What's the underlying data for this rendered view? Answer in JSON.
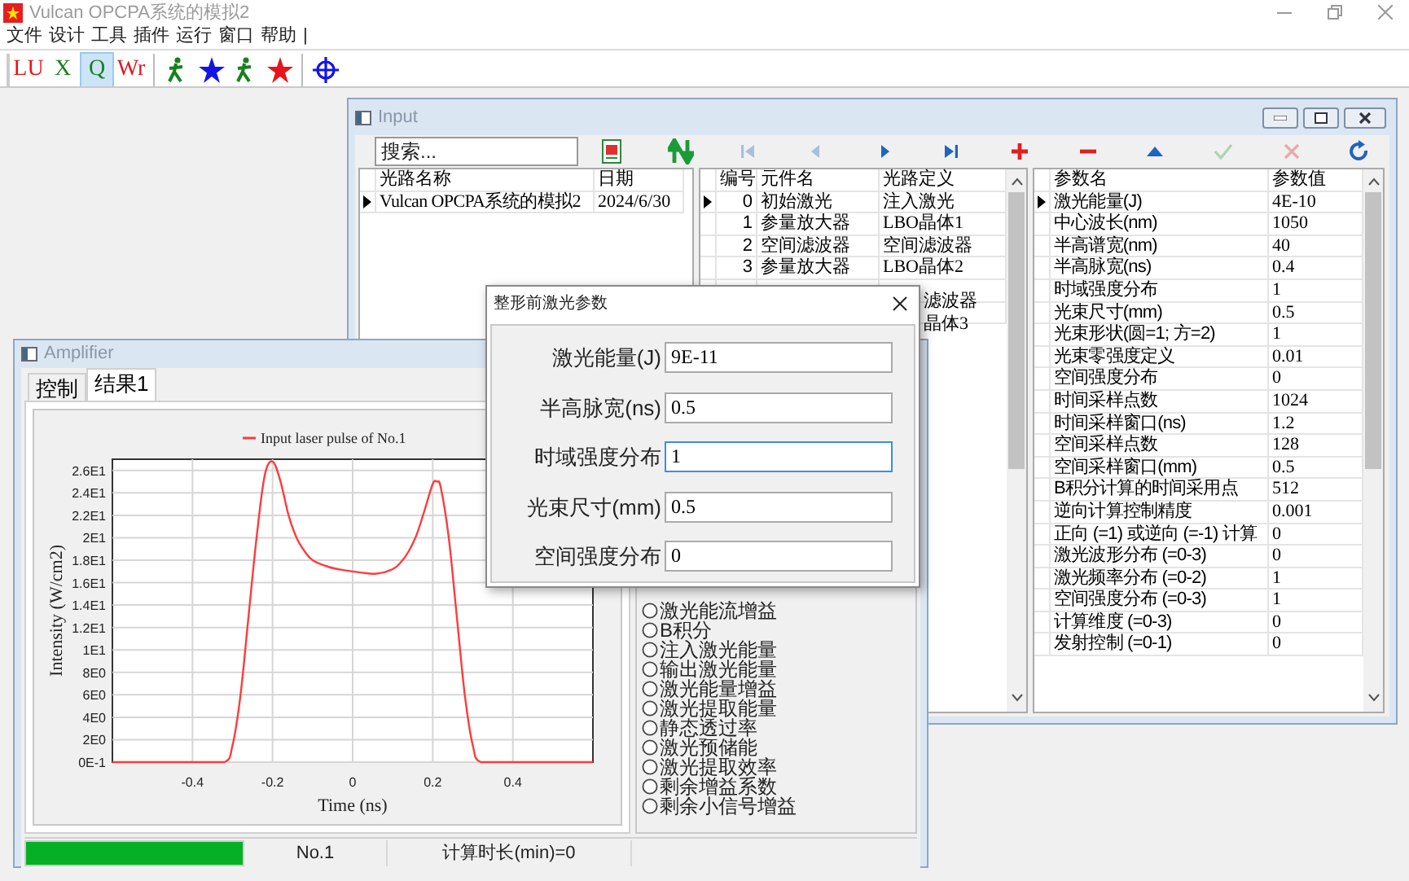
{
  "app": {
    "title": "Vulcan OPCPA系统的模拟2"
  },
  "menu": [
    "文件",
    "设计",
    "工具",
    "插件",
    "运行",
    "窗口",
    "帮助",
    "|"
  ],
  "toolbar": [
    {
      "kind": "text",
      "label": "LU",
      "color": "#e8141b",
      "selected": false
    },
    {
      "kind": "text",
      "label": "X",
      "color": "#17801c",
      "selected": false
    },
    {
      "kind": "text",
      "label": "Q",
      "color": "#17801c",
      "selected": true
    },
    {
      "kind": "text",
      "label": "Wr",
      "color": "#e8141b",
      "selected": false
    },
    {
      "kind": "separator"
    },
    {
      "kind": "figure",
      "color": "#17801c",
      "selected": false
    },
    {
      "kind": "star",
      "color": "#1414e6",
      "selected": false
    },
    {
      "kind": "figure",
      "color": "#17801c",
      "selected": false
    },
    {
      "kind": "star",
      "color": "#e8141b",
      "selected": false
    },
    {
      "kind": "separator"
    },
    {
      "kind": "target",
      "color": "#1414e6",
      "selected": false
    }
  ],
  "input_window": {
    "title": "Input",
    "search": {
      "placeholder": "搜索..."
    },
    "tools": [
      {
        "kind": "report",
        "disabled": false
      },
      {
        "kind": "sort",
        "disabled": false
      },
      {
        "kind": "first",
        "disabled": true
      },
      {
        "kind": "prev",
        "disabled": true
      },
      {
        "kind": "next",
        "disabled": false
      },
      {
        "kind": "last",
        "disabled": false
      },
      {
        "kind": "add",
        "disabled": false
      },
      {
        "kind": "remove",
        "disabled": false
      },
      {
        "kind": "up",
        "disabled": false
      },
      {
        "kind": "confirm",
        "disabled": true
      },
      {
        "kind": "cancel",
        "disabled": true
      },
      {
        "kind": "refresh",
        "disabled": false
      }
    ],
    "paths": {
      "columns": [
        "光路名称",
        "日期"
      ],
      "rows": [
        {
          "name": "Vulcan OPCPA系统的模拟2",
          "date": "2024/6/30",
          "current": true
        }
      ]
    },
    "elements": {
      "columns": [
        "编号",
        "元件名",
        "光路定义"
      ],
      "rows": [
        {
          "no": "0",
          "name": "初始激光",
          "definition": "注入激光",
          "current": true
        },
        {
          "no": "1",
          "name": "参量放大器",
          "definition": "LBO晶体1",
          "current": false
        },
        {
          "no": "2",
          "name": "空间滤波器",
          "definition": "空间滤波器",
          "current": false
        },
        {
          "no": "3",
          "name": "参量放大器",
          "definition": "LBO晶体2",
          "current": false
        },
        {
          "definition": "滤波器"
        },
        {
          "definition": "晶体3"
        }
      ]
    },
    "params": {
      "columns": [
        "参数名",
        "参数值"
      ],
      "rows": [
        {
          "name": "激光能量(J)",
          "value": "4E-10",
          "current": true
        },
        {
          "name": "中心波长(nm)",
          "value": "1050",
          "current": false
        },
        {
          "name": "半高谱宽(nm)",
          "value": "40",
          "current": false
        },
        {
          "name": "半高脉宽(ns)",
          "value": "0.4",
          "current": false
        },
        {
          "name": "时域强度分布",
          "value": "1",
          "current": false
        },
        {
          "name": "光束尺寸(mm)",
          "value": "0.5",
          "current": false
        },
        {
          "name": "光束形状(圆=1; 方=2)",
          "value": "1",
          "current": false
        },
        {
          "name": "光束零强度定义",
          "value": "0.01",
          "current": false
        },
        {
          "name": "空间强度分布",
          "value": "0",
          "current": false
        },
        {
          "name": "时间采样点数",
          "value": "1024",
          "current": false
        },
        {
          "name": "时间采样窗口(ns)",
          "value": "1.2",
          "current": false
        },
        {
          "name": "空间采样点数",
          "value": "128",
          "current": false
        },
        {
          "name": "空间采样窗口(mm)",
          "value": "0.5",
          "current": false
        },
        {
          "name": "B积分计算的时间采用点",
          "value": "512",
          "current": false
        },
        {
          "name": "逆向计算控制精度",
          "value": "0.001",
          "current": false
        },
        {
          "name": "正向 (=1) 或逆向 (=-1) 计算",
          "value": "0",
          "current": false
        },
        {
          "name": "激光波形分布 (=0-3)",
          "value": "0",
          "current": false
        },
        {
          "name": "激光频率分布 (=0-2)",
          "value": "1",
          "current": false
        },
        {
          "name": "空间强度分布 (=0-3)",
          "value": "1",
          "current": false
        },
        {
          "name": "计算维度 (=0-3)",
          "value": "0",
          "current": false
        },
        {
          "name": "发射控制 (=0-1)",
          "value": "0",
          "current": false
        }
      ]
    }
  },
  "amplifier": {
    "title": "Amplifier",
    "tabs": [
      {
        "label": "控制",
        "selected": false
      },
      {
        "label": "结果1",
        "selected": true
      }
    ],
    "chart_data": {
      "type": "line",
      "xlabel": "Time (ns)",
      "ylabel": "Intensity (W/cm2)",
      "x": [
        -0.6,
        -0.5,
        -0.4,
        -0.32,
        -0.3,
        -0.28,
        -0.26,
        -0.24,
        -0.22,
        -0.2,
        -0.18,
        -0.16,
        -0.14,
        -0.12,
        -0.1,
        -0.06,
        -0.02,
        0.02,
        0.06,
        0.1,
        0.12,
        0.14,
        0.16,
        0.18,
        0.2,
        0.21,
        0.22,
        0.24,
        0.26,
        0.28,
        0.3,
        0.32,
        0.4,
        0.5,
        0.6
      ],
      "series": [
        {
          "name": "Input laser pulse of No.1",
          "color": "#ff3b3b",
          "values": [
            0,
            0,
            0,
            0,
            1.5,
            6,
            13,
            20,
            25.5,
            26.8,
            25,
            22,
            20,
            18.8,
            18,
            17.4,
            17.1,
            16.9,
            16.8,
            17.2,
            17.8,
            18.8,
            20.3,
            22.5,
            24.8,
            25,
            24.5,
            20,
            13,
            6,
            1.5,
            0,
            0,
            0,
            0
          ]
        }
      ],
      "xlim": [
        -0.6,
        0.6
      ],
      "ylim": [
        0,
        27
      ],
      "grid": true,
      "xticks": [
        {
          "value": -0.4,
          "label": "-0.4"
        },
        {
          "value": -0.2,
          "label": "-0.2"
        },
        {
          "value": 0,
          "label": "0"
        },
        {
          "value": 0.2,
          "label": "0.2"
        },
        {
          "value": 0.4,
          "label": "0.4"
        }
      ],
      "yticks": [
        {
          "value": 0,
          "label": "0E-1"
        },
        {
          "value": 2,
          "label": "2E0"
        },
        {
          "value": 4,
          "label": "4E0"
        },
        {
          "value": 6,
          "label": "6E0"
        },
        {
          "value": 8,
          "label": "8E0"
        },
        {
          "value": 10,
          "label": "1E1"
        },
        {
          "value": 12,
          "label": "1.2E1"
        },
        {
          "value": 14,
          "label": "1.4E1"
        },
        {
          "value": 16,
          "label": "1.6E1"
        },
        {
          "value": 18,
          "label": "1.8E1"
        },
        {
          "value": 20,
          "label": "2E1"
        },
        {
          "value": 22,
          "label": "2.2E1"
        },
        {
          "value": 24,
          "label": "2.4E1"
        },
        {
          "value": 26,
          "label": "2.6E1"
        }
      ]
    },
    "options": [
      {
        "label": "激光能流增益",
        "selected": false
      },
      {
        "label": "B积分",
        "selected": false
      },
      {
        "label": "注入激光能量",
        "selected": false
      },
      {
        "label": "输出激光能量",
        "selected": false
      },
      {
        "label": "激光能量增益",
        "selected": false
      },
      {
        "label": "激光提取能量",
        "selected": false
      },
      {
        "label": "静态透过率",
        "selected": false
      },
      {
        "label": "激光预储能",
        "selected": false
      },
      {
        "label": "激光提取效率",
        "selected": false
      },
      {
        "label": "剩余增益系数",
        "selected": false
      },
      {
        "label": "剩余小信号增益",
        "selected": false
      }
    ],
    "status": {
      "level": 1,
      "cells": [
        "No.1",
        "计算时长(min)=0"
      ]
    }
  },
  "dialog": {
    "title": "整形前激光参数",
    "fields": [
      {
        "label": "激光能量(J)",
        "value": "9E-11",
        "focused": false
      },
      {
        "label": "半高脉宽(ns)",
        "value": "0.5",
        "focused": false
      },
      {
        "label": "时域强度分布",
        "value": "1",
        "focused": true
      },
      {
        "label": "光束尺寸(mm)",
        "value": "0.5",
        "focused": false
      },
      {
        "label": "空间强度分布",
        "value": "0",
        "focused": false
      }
    ]
  }
}
